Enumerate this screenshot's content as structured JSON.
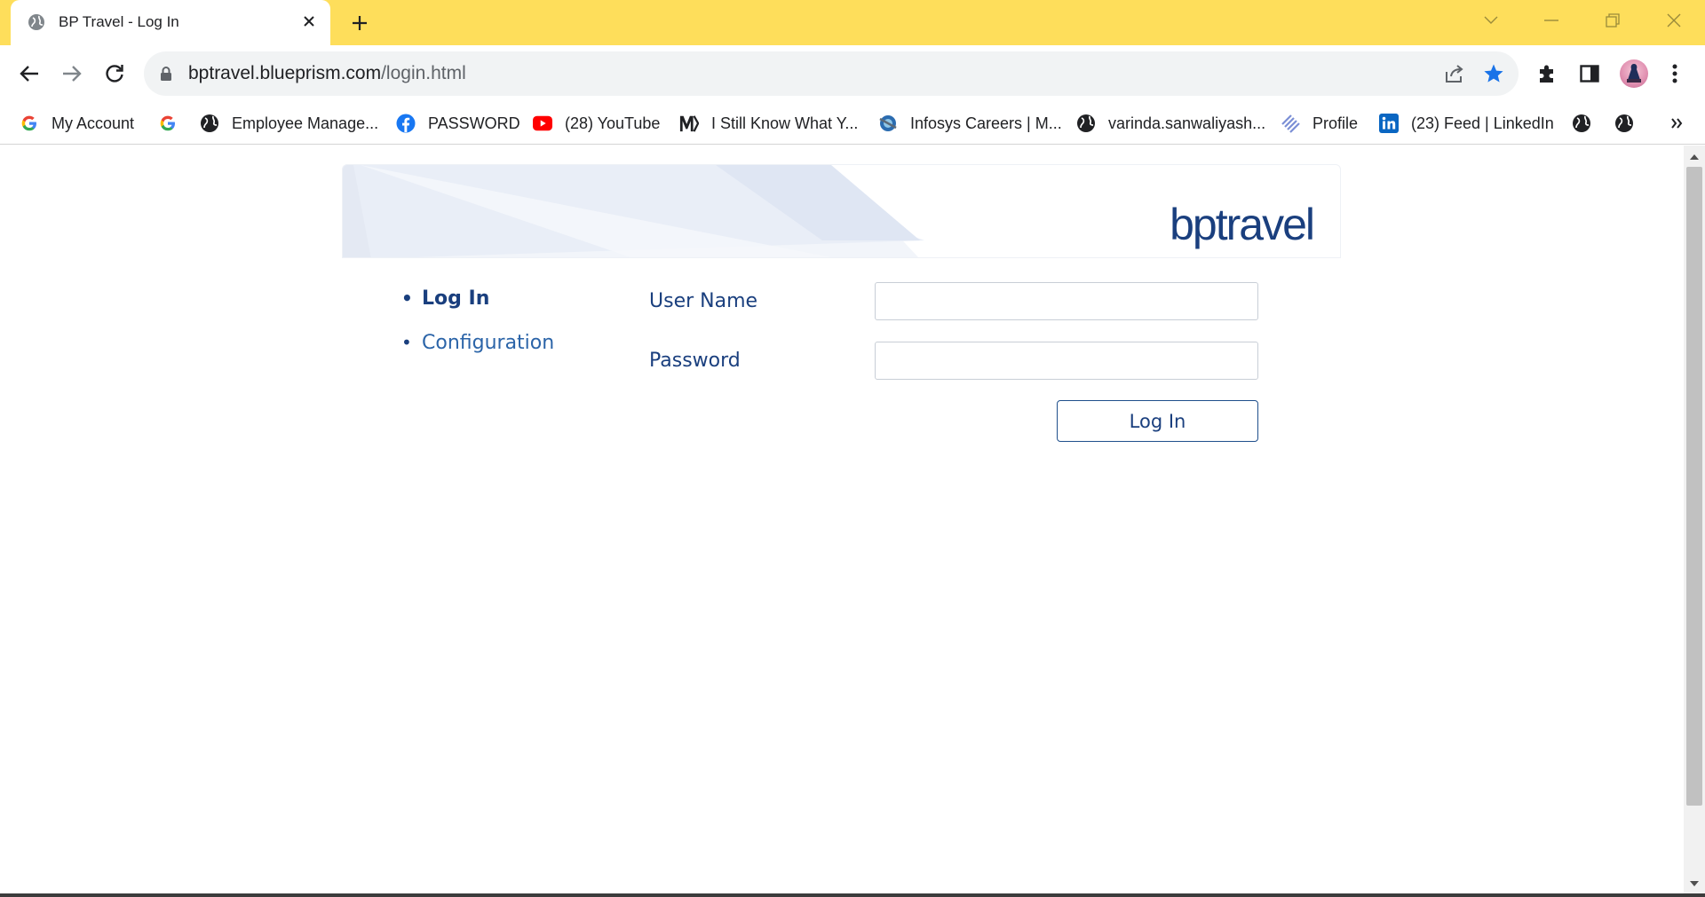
{
  "browser": {
    "tab": {
      "title": "BP Travel - Log In"
    },
    "address_bar": {
      "host": "bptravel.blueprism.com",
      "path": "/login.html"
    },
    "bookmarks": [
      {
        "label": "My Account",
        "icon": "google-icon"
      },
      {
        "label": "",
        "icon": "google-icon"
      },
      {
        "label": "Employee Manage...",
        "icon": "globe-icon"
      },
      {
        "label": "PASSWORD",
        "icon": "facebook-icon"
      },
      {
        "label": "(28) YouTube",
        "icon": "youtube-icon"
      },
      {
        "label": "I Still Know What Y...",
        "icon": "mx-logo-icon"
      },
      {
        "label": "Infosys Careers | M...",
        "icon": "infosys-icon"
      },
      {
        "label": "varinda.sanwaliyash...",
        "icon": "globe-icon"
      },
      {
        "label": "Profile",
        "icon": "stripes-icon"
      },
      {
        "label": "(23) Feed | LinkedIn",
        "icon": "linkedin-icon"
      },
      {
        "label": "",
        "icon": "globe-icon"
      },
      {
        "label": "",
        "icon": "globe-icon"
      }
    ],
    "colors": {
      "tabstrip": "#fede5b",
      "star": "#1a73e8"
    }
  },
  "page": {
    "logo": "bptravel",
    "menu": {
      "login": "Log In",
      "configuration": "Configuration"
    },
    "form": {
      "username_label": "User Name",
      "username_value": "",
      "password_label": "Password",
      "password_value": "",
      "submit_label": "Log In"
    },
    "colors": {
      "brand": "#1a3f7e",
      "link": "#2b64a8"
    }
  }
}
